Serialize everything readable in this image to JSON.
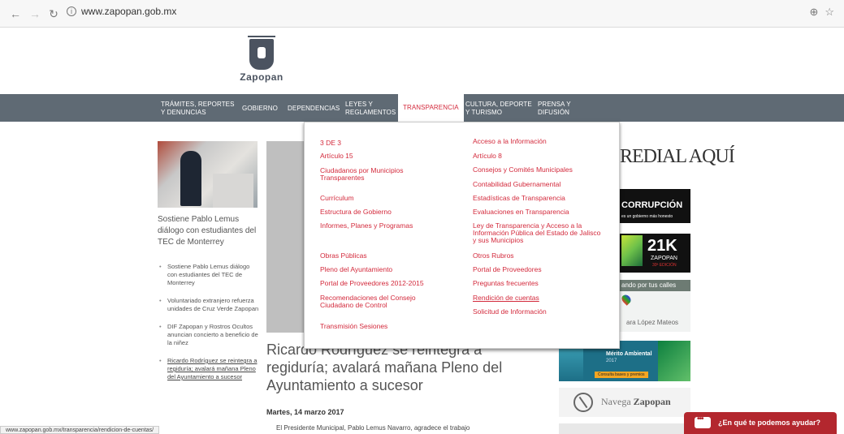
{
  "browser": {
    "url": "www.zapopan.gob.mx",
    "status_url": "www.zapopan.gob.mx/transparencia/rendicion-de-cuentas/"
  },
  "logo": {
    "name": "Zapopan"
  },
  "nav": {
    "items": [
      {
        "label": "TRÁMITES, REPORTES\nY DENUNCIAS"
      },
      {
        "label": "GOBIERNO"
      },
      {
        "label": "DEPENDENCIAS"
      },
      {
        "label": "LEYES Y\nREGLAMENTOS"
      },
      {
        "label": "TRANSPARENCIA"
      },
      {
        "label": "CULTURA, DEPORTE\nY TURISMO"
      },
      {
        "label": "PRENSA Y\nDIFUSIÓN"
      }
    ]
  },
  "left": {
    "featured_caption": "Sostiene Pablo Lemus diálogo con estudiantes del TEC de Monterrey",
    "news": [
      "Sostiene Pablo Lemus diálogo con estudiantes del TEC de Monterrey",
      "Voluntariado extranjero refuerza unidades de Cruz Verde Zapopan",
      "DIF Zapopan y Rostros Ocultos anuncian concierto a beneficio de la niñez",
      "Ricardo Rodríguez se reintegra a regiduría; avalará mañana Pleno del Ayuntamiento a sucesor"
    ]
  },
  "dropdown": {
    "col1": [
      "3 DE 3",
      "Artículo 15",
      "Ciudadanos por Municipios Transparentes",
      "Currículum",
      "Estructura de Gobierno",
      "Informes, Planes y Programas",
      "Obras Públicas",
      "Pleno del Ayuntamiento",
      "Portal de Proveedores 2012-2015",
      "Recomendaciones del Consejo Ciudadano de Control",
      "Transmisión Sesiones"
    ],
    "col2": [
      "Acceso a la Información",
      "Artículo 8",
      "Consejos y Comités Municipales",
      "Contabilidad Gubernamental",
      "Estadísticas de Transparencia",
      "Evaluaciones en Transparencia",
      "Ley de Transparencia y Acceso a la Información Pública del Estado de Jalisco y sus Municipios",
      "Otros Rubros",
      "Portal de Proveedores",
      "Preguntas frecuentes",
      "Rendición de cuentas",
      "Solicitud de Información"
    ]
  },
  "article": {
    "title": "Ricardo Rodríguez se reintegra a regiduría; avalará mañana Pleno del Ayuntamiento a sucesor",
    "date": "Martes, 14 marzo 2017",
    "body": "El Presidente Municipal, Pablo Lemus Navarro, agradece el trabajo"
  },
  "right": {
    "predial": "REDIAL AQUÍ",
    "corrupcion_big": "CORRUPCIÓN",
    "corrupcion_small": "es un gobierno más honesto",
    "race_num": "21K",
    "race_city": "ZAPOPAN",
    "race_edition": "30ª EDICIÓN",
    "calles_top": "ando por tus calles",
    "calles_bottom": "ara López Mateos",
    "ambiental_title": "Mérito Ambiental",
    "ambiental_year": "2017",
    "ambiental_btn": "Consulta bases y premios",
    "navega_a": "Navega ",
    "navega_b": "Zapopan"
  },
  "chat": {
    "label": "¿En qué te podemos ayudar?"
  },
  "colors": {
    "nav_bg": "#5f6a74",
    "accent": "#d32a3c",
    "chat": "#b3272e"
  }
}
